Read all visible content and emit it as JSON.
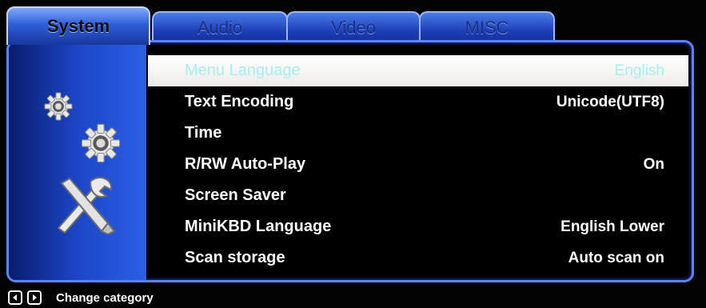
{
  "tabs": [
    {
      "id": "system",
      "label": "System",
      "active": true
    },
    {
      "id": "audio",
      "label": "Audio",
      "active": false
    },
    {
      "id": "video",
      "label": "Video",
      "active": false
    },
    {
      "id": "misc",
      "label": "MISC",
      "active": false
    }
  ],
  "sidebar": {
    "icons": [
      "small-gear-icon",
      "large-gear-icon",
      "wrench-screwdriver-icon"
    ]
  },
  "settings": [
    {
      "label": "Menu Language",
      "value": "English",
      "selected": true
    },
    {
      "label": "Text Encoding",
      "value": "Unicode(UTF8)",
      "selected": false
    },
    {
      "label": "Time",
      "value": "",
      "selected": false
    },
    {
      "label": "R/RW Auto-Play",
      "value": "On",
      "selected": false
    },
    {
      "label": "Screen Saver",
      "value": "",
      "selected": false
    },
    {
      "label": "MiniKBD Language",
      "value": "English Lower",
      "selected": false
    },
    {
      "label": "Scan storage",
      "value": "Auto scan on",
      "selected": false
    }
  ],
  "footer": {
    "hint": "Change category",
    "keys": [
      "left-arrow-icon",
      "right-arrow-icon"
    ]
  },
  "colors": {
    "accent": "#2b5fe6",
    "selected_row_bg": "#ffffff",
    "selected_row_text": "#a8eef0"
  }
}
